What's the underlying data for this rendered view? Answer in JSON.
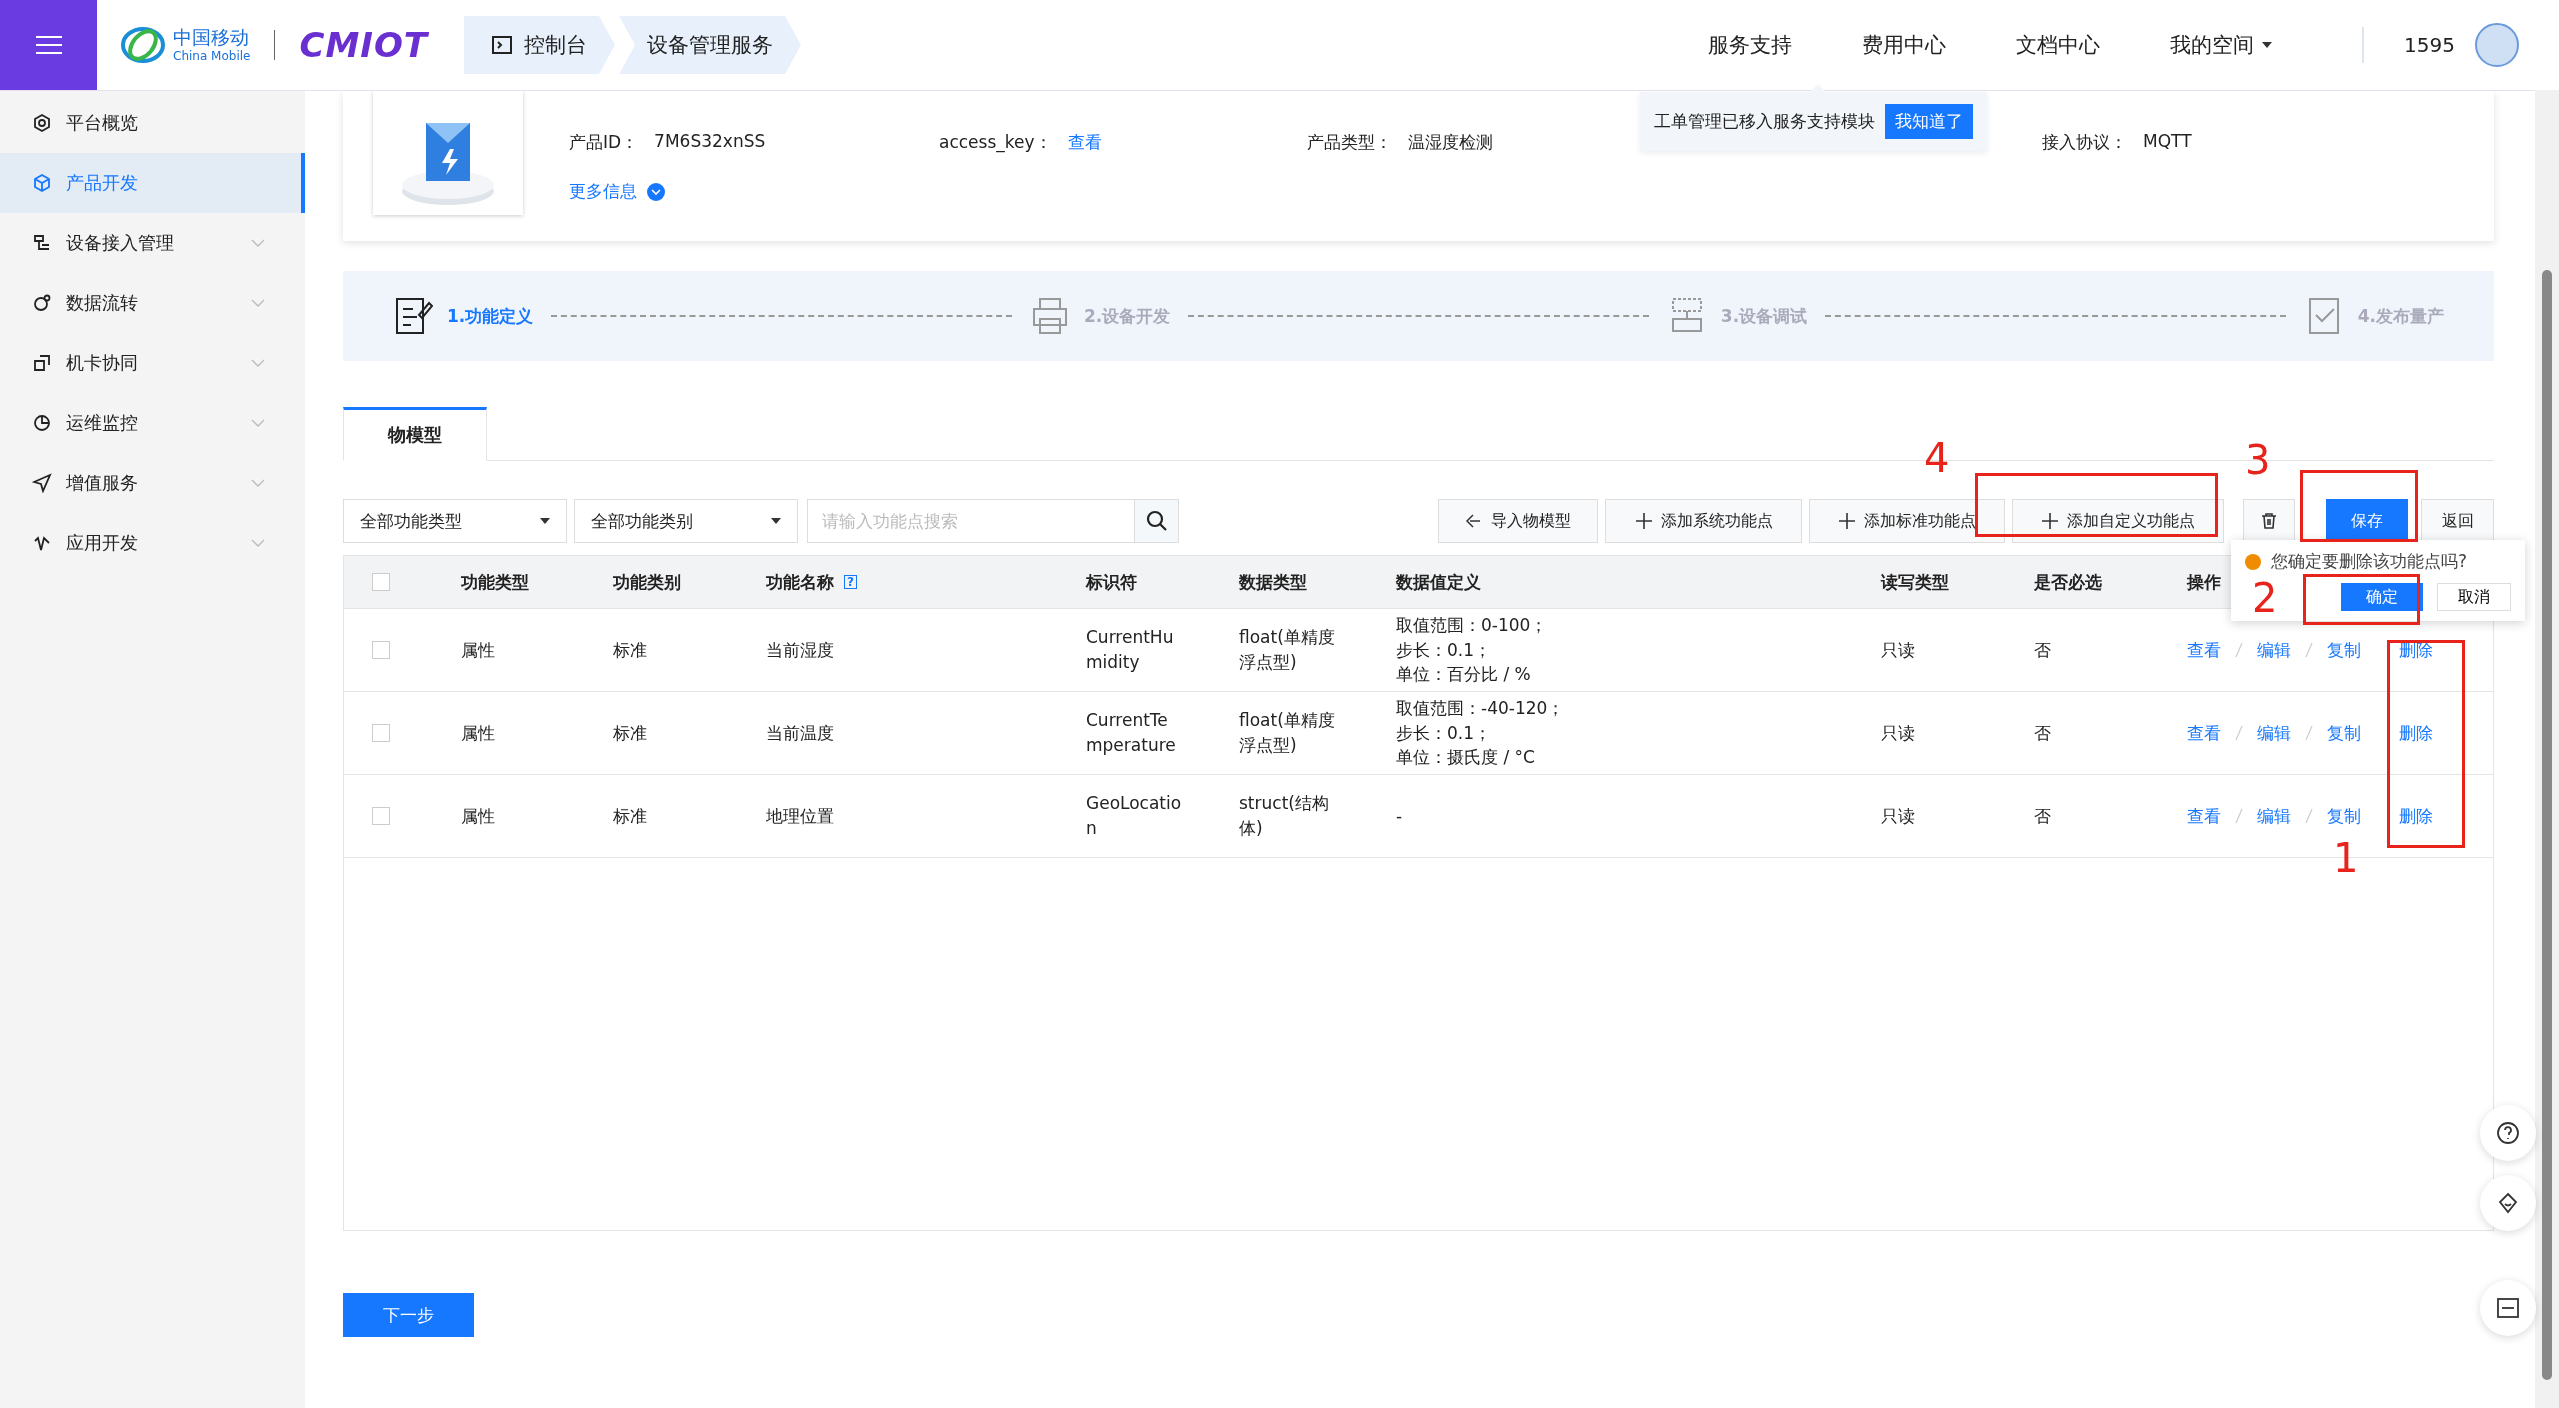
{
  "header": {
    "brand": "中国移动",
    "brand_en": "China Mobile",
    "logo": "CMIOT",
    "breadcrumb": [
      {
        "label": "控制台",
        "kind": "console"
      },
      {
        "label": "设备管理服务",
        "kind": "plain"
      }
    ],
    "nav": [
      {
        "label": "服务支持",
        "dropdown": false
      },
      {
        "label": "费用中心",
        "dropdown": false
      },
      {
        "label": "文档中心",
        "dropdown": false
      },
      {
        "label": "我的空间",
        "dropdown": true
      }
    ],
    "user": "1595",
    "tooltip": {
      "text": "工单管理已移入服务支持模块",
      "button": "我知道了"
    }
  },
  "sidebar": {
    "items": [
      {
        "label": "平台概览",
        "selected": false,
        "expandable": false
      },
      {
        "label": "产品开发",
        "selected": true,
        "expandable": false
      },
      {
        "label": "设备接入管理",
        "selected": false,
        "expandable": true
      },
      {
        "label": "数据流转",
        "selected": false,
        "expandable": true
      },
      {
        "label": "机卡协同",
        "selected": false,
        "expandable": true
      },
      {
        "label": "运维监控",
        "selected": false,
        "expandable": true
      },
      {
        "label": "增值服务",
        "selected": false,
        "expandable": true
      },
      {
        "label": "应用开发",
        "selected": false,
        "expandable": true
      }
    ]
  },
  "product": {
    "fields": [
      {
        "label": "产品ID：",
        "value": "7M6S32xnSS",
        "kind": "text"
      },
      {
        "label": "access_key：",
        "value": "查看",
        "kind": "link"
      },
      {
        "label": "产品类型：",
        "value": "温湿度检测",
        "kind": "text"
      },
      {
        "label": "接入协议：",
        "value": "MQTT",
        "kind": "text"
      }
    ],
    "more": "更多信息"
  },
  "steps": [
    {
      "label": "1.功能定义",
      "selected": true
    },
    {
      "label": "2.设备开发",
      "selected": false
    },
    {
      "label": "3.设备调试",
      "selected": false
    },
    {
      "label": "4.发布量产",
      "selected": false
    }
  ],
  "tabs": [
    {
      "label": "物模型",
      "selected": true
    }
  ],
  "filters": [
    {
      "value": "全部功能类型"
    },
    {
      "value": "全部功能类别"
    }
  ],
  "search": {
    "placeholder": "请输入功能点搜索"
  },
  "toolbar": [
    {
      "label": "导入物模型",
      "kind": "import"
    },
    {
      "label": "添加系统功能点",
      "kind": "add"
    },
    {
      "label": "添加标准功能点",
      "kind": "add"
    },
    {
      "label": "添加自定义功能点",
      "kind": "add"
    },
    {
      "kind": "delete"
    },
    {
      "label": "保存",
      "kind": "primary"
    },
    {
      "label": "返回",
      "kind": "default"
    }
  ],
  "table": {
    "all_checked": false,
    "columns": [
      {
        "label": "功能类型"
      },
      {
        "label": "功能类别"
      },
      {
        "label": "功能名称",
        "help": "?"
      },
      {
        "label": "标识符"
      },
      {
        "label": "数据类型"
      },
      {
        "label": "数据值定义"
      },
      {
        "label": "读写类型"
      },
      {
        "label": "是否必选"
      },
      {
        "label": "操作"
      }
    ],
    "rows": [
      {
        "checked": false,
        "type": "属性",
        "category": "标准",
        "name": "当前湿度",
        "identifier": "CurrentHumidity",
        "data_type": "float(单精度浮点型)",
        "definition": [
          "取值范围：0-100；",
          "步长：0.1；",
          "单位：百分比 / %"
        ],
        "rw": "只读",
        "required": "否",
        "actions": [
          "查看",
          "编辑",
          "复制",
          "删除"
        ]
      },
      {
        "checked": false,
        "type": "属性",
        "category": "标准",
        "name": "当前温度",
        "identifier": "CurrentTemperature",
        "data_type": "float(单精度浮点型)",
        "definition": [
          "取值范围：-40-120；",
          "步长：0.1；",
          "单位：摄氏度 / °C"
        ],
        "rw": "只读",
        "required": "否",
        "actions": [
          "查看",
          "编辑",
          "复制",
          "删除"
        ]
      },
      {
        "checked": false,
        "type": "属性",
        "category": "标准",
        "name": "地理位置",
        "identifier": "GeoLocation",
        "data_type": "struct(结构体)",
        "definition": [
          "-"
        ],
        "rw": "只读",
        "required": "否",
        "actions": [
          "查看",
          "编辑",
          "复制",
          "删除"
        ]
      }
    ]
  },
  "popconfirm": {
    "message": "您确定要删除该功能点吗?",
    "confirm": "确定",
    "cancel": "取消"
  },
  "next": "下一步",
  "annotations": [
    {
      "label": "1"
    },
    {
      "label": "2"
    },
    {
      "label": "3"
    },
    {
      "label": "4"
    }
  ]
}
